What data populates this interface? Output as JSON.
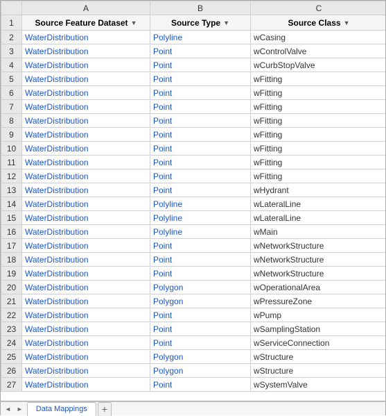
{
  "columns": {
    "row_num_header": "",
    "a_header": "A",
    "b_header": "B",
    "c_header": "C"
  },
  "headers": {
    "row1_num": "1",
    "col_a": "Source Feature Dataset",
    "col_b": "Source Type",
    "col_c": "Source Class"
  },
  "rows": [
    {
      "num": "2",
      "a": "WaterDistribution",
      "b": "Polyline",
      "c": "wCasing"
    },
    {
      "num": "3",
      "a": "WaterDistribution",
      "b": "Point",
      "c": "wControlValve"
    },
    {
      "num": "4",
      "a": "WaterDistribution",
      "b": "Point",
      "c": "wCurbStopValve"
    },
    {
      "num": "5",
      "a": "WaterDistribution",
      "b": "Point",
      "c": "wFitting"
    },
    {
      "num": "6",
      "a": "WaterDistribution",
      "b": "Point",
      "c": "wFitting"
    },
    {
      "num": "7",
      "a": "WaterDistribution",
      "b": "Point",
      "c": "wFitting"
    },
    {
      "num": "8",
      "a": "WaterDistribution",
      "b": "Point",
      "c": "wFitting"
    },
    {
      "num": "9",
      "a": "WaterDistribution",
      "b": "Point",
      "c": "wFitting"
    },
    {
      "num": "10",
      "a": "WaterDistribution",
      "b": "Point",
      "c": "wFitting"
    },
    {
      "num": "11",
      "a": "WaterDistribution",
      "b": "Point",
      "c": "wFitting"
    },
    {
      "num": "12",
      "a": "WaterDistribution",
      "b": "Point",
      "c": "wFitting"
    },
    {
      "num": "13",
      "a": "WaterDistribution",
      "b": "Point",
      "c": "wHydrant"
    },
    {
      "num": "14",
      "a": "WaterDistribution",
      "b": "Polyline",
      "c": "wLateralLine"
    },
    {
      "num": "15",
      "a": "WaterDistribution",
      "b": "Polyline",
      "c": "wLateralLine"
    },
    {
      "num": "16",
      "a": "WaterDistribution",
      "b": "Polyline",
      "c": "wMain"
    },
    {
      "num": "17",
      "a": "WaterDistribution",
      "b": "Point",
      "c": "wNetworkStructure"
    },
    {
      "num": "18",
      "a": "WaterDistribution",
      "b": "Point",
      "c": "wNetworkStructure"
    },
    {
      "num": "19",
      "a": "WaterDistribution",
      "b": "Point",
      "c": "wNetworkStructure"
    },
    {
      "num": "20",
      "a": "WaterDistribution",
      "b": "Polygon",
      "c": "wOperationalArea"
    },
    {
      "num": "21",
      "a": "WaterDistribution",
      "b": "Polygon",
      "c": "wPressureZone"
    },
    {
      "num": "22",
      "a": "WaterDistribution",
      "b": "Point",
      "c": "wPump"
    },
    {
      "num": "23",
      "a": "WaterDistribution",
      "b": "Point",
      "c": "wSamplingStation"
    },
    {
      "num": "24",
      "a": "WaterDistribution",
      "b": "Point",
      "c": "wServiceConnection"
    },
    {
      "num": "25",
      "a": "WaterDistribution",
      "b": "Polygon",
      "c": "wStructure"
    },
    {
      "num": "26",
      "a": "WaterDistribution",
      "b": "Polygon",
      "c": "wStructure"
    },
    {
      "num": "27",
      "a": "WaterDistribution",
      "b": "Point",
      "c": "wSystemValve"
    }
  ],
  "tab": {
    "label": "Data Mappings",
    "add_label": "+"
  },
  "scroll": {
    "left_arrow": "◄",
    "right_arrow": "►"
  }
}
